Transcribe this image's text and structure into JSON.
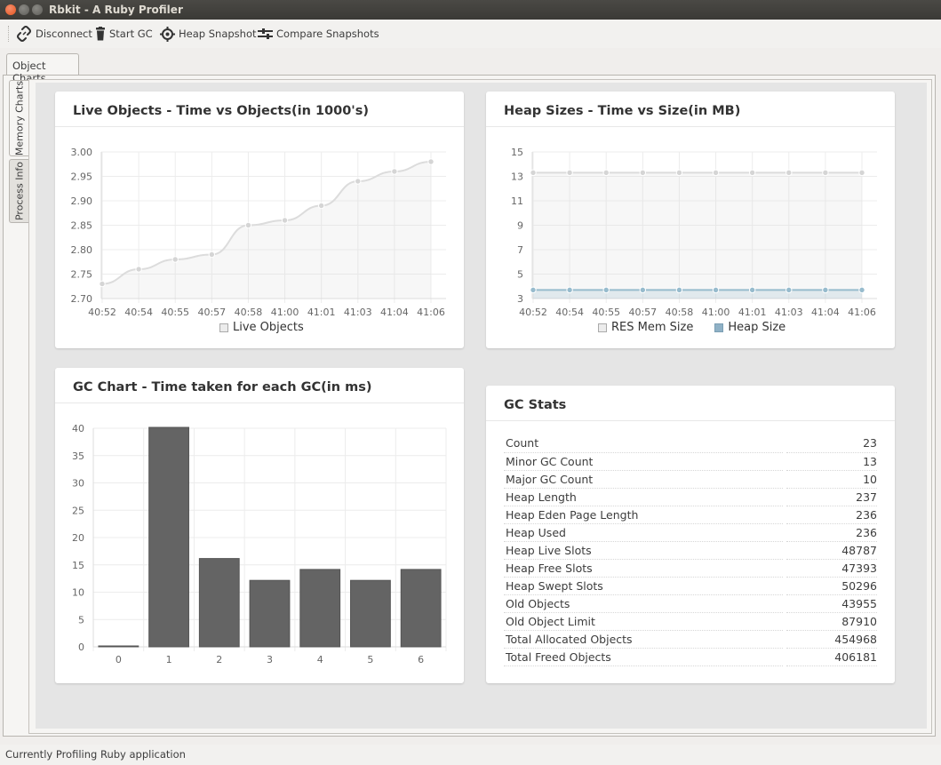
{
  "window": {
    "title": "Rbkit - A Ruby Profiler"
  },
  "toolbar": {
    "disconnect": "Disconnect",
    "start_gc": "Start GC",
    "heap_snapshot": "Heap Snapshot",
    "compare_snapshots": "Compare  Snapshots"
  },
  "tabs": {
    "outer": [
      "Object Charts"
    ],
    "side": [
      "Memory Charts",
      "Process Info"
    ]
  },
  "live_objects": {
    "title": "Live Objects - Time vs Objects(in 1000's)",
    "legend": "Live Objects"
  },
  "heap_sizes": {
    "title": "Heap Sizes - Time vs Size(in MB)",
    "legend": [
      "RES Mem Size",
      "Heap Size"
    ]
  },
  "gc_chart": {
    "title": "GC Chart - Time taken for each GC(in ms)"
  },
  "gc_stats": {
    "title": "GC Stats",
    "rows": [
      {
        "label": "Count",
        "value": "23"
      },
      {
        "label": "Minor GC Count",
        "value": "13"
      },
      {
        "label": "Major GC Count",
        "value": "10"
      },
      {
        "label": "Heap Length",
        "value": "237"
      },
      {
        "label": "Heap Eden Page Length",
        "value": "236"
      },
      {
        "label": "Heap Used",
        "value": "236"
      },
      {
        "label": "Heap Live Slots",
        "value": "48787"
      },
      {
        "label": "Heap Free Slots",
        "value": "47393"
      },
      {
        "label": "Heap Swept Slots",
        "value": "50296"
      },
      {
        "label": "Old Objects",
        "value": "43955"
      },
      {
        "label": "Old Object Limit",
        "value": "87910"
      },
      {
        "label": "Total Allocated Objects",
        "value": "454968"
      },
      {
        "label": "Total Freed Objects",
        "value": "406181"
      }
    ]
  },
  "status": {
    "text": "Currently Profiling Ruby application"
  },
  "colors": {
    "line_gray": "#dcdcdc",
    "heap_blue": "#97bbcd",
    "bar": "#646464"
  },
  "chart_data": [
    {
      "type": "area",
      "title": "Live Objects - Time vs Objects(in 1000's)",
      "categories": [
        "40:52",
        "40:54",
        "40:55",
        "40:57",
        "40:58",
        "41:00",
        "41:01",
        "41:03",
        "41:04",
        "41:06"
      ],
      "series": [
        {
          "name": "Live Objects",
          "values": [
            2.73,
            2.76,
            2.78,
            2.79,
            2.85,
            2.86,
            2.89,
            2.94,
            2.96,
            2.98
          ]
        }
      ],
      "ylim": [
        2.7,
        3.0
      ],
      "yticks": [
        "2.70",
        "2.75",
        "2.80",
        "2.85",
        "2.90",
        "2.95",
        "3.00"
      ],
      "legend": "bottom",
      "grid": true
    },
    {
      "type": "line",
      "title": "Heap Sizes - Time vs Size(in MB)",
      "categories": [
        "40:52",
        "40:54",
        "40:55",
        "40:57",
        "40:58",
        "41:00",
        "41:01",
        "41:03",
        "41:04",
        "41:06"
      ],
      "series": [
        {
          "name": "RES Mem Size",
          "values": [
            13.3,
            13.3,
            13.3,
            13.3,
            13.3,
            13.3,
            13.3,
            13.3,
            13.3,
            13.3
          ]
        },
        {
          "name": "Heap Size",
          "values": [
            3.7,
            3.7,
            3.7,
            3.7,
            3.7,
            3.7,
            3.7,
            3.7,
            3.7,
            3.7
          ]
        }
      ],
      "ylim": [
        3,
        15
      ],
      "yticks": [
        "3",
        "5",
        "7",
        "9",
        "11",
        "13",
        "15"
      ],
      "legend": "bottom",
      "grid": true
    },
    {
      "type": "bar",
      "title": "GC Chart - Time taken for each GC(in ms)",
      "categories": [
        "0",
        "1",
        "2",
        "3",
        "4",
        "5",
        "6"
      ],
      "values": [
        0,
        40,
        16,
        12,
        14,
        12,
        14
      ],
      "ylim": [
        0,
        40
      ],
      "yticks": [
        "0",
        "5",
        "10",
        "15",
        "20",
        "25",
        "30",
        "35",
        "40"
      ],
      "grid": true
    }
  ]
}
